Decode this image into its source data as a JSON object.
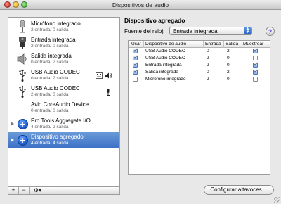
{
  "window": {
    "title": "Dispositivos de audio"
  },
  "devices": [
    {
      "name": "Micrófono integrado",
      "sub": "2 entrada/ 0 salida",
      "icon": "microphone-icon",
      "right_icons": []
    },
    {
      "name": "Entrada integrada",
      "sub": "2 entrada/ 0 salida",
      "icon": "line-in-icon",
      "right_icons": []
    },
    {
      "name": "Salida integrada",
      "sub": "0 entrada/ 2 salida",
      "icon": "speaker-icon",
      "right_icons": []
    },
    {
      "name": "USB Audio CODEC",
      "sub": "0 entrada/ 2 salida",
      "icon": "usb-icon",
      "right_icons": [
        "finder-icon",
        "speaker-volume-icon"
      ]
    },
    {
      "name": "USB Audio CODEC",
      "sub": "2 entrada/ 0 salida",
      "icon": "usb-icon",
      "right_icons": [
        "microphone-small-icon"
      ]
    },
    {
      "name": "Avid CoreAudio Device",
      "sub": "0 entrada/ 0 salida",
      "icon": "",
      "right_icons": []
    },
    {
      "name": "Pro Tools Aggregate I/O",
      "sub": "4 entrada/ 2 salida",
      "icon": "aggregate-icon",
      "right_icons": [],
      "disclosure": true
    },
    {
      "name": "Dispositivo agregado",
      "sub": "4 entrada/ 4 salida",
      "icon": "aggregate-icon",
      "right_icons": [],
      "disclosure": true,
      "selected": true
    }
  ],
  "list_toolbar": {
    "add": "+",
    "remove": "−",
    "gear": "⚙▾"
  },
  "detail": {
    "title": "Dispositivo agregado",
    "clock_label": "Fuente del reloj:",
    "clock_value": "Entrada integrada",
    "help": "?"
  },
  "table": {
    "headers": [
      "Usar",
      "Dispositivo de audio",
      "Entrada",
      "Salida",
      "Muestrear"
    ],
    "rows": [
      {
        "use": true,
        "device": "USB Audio CODEC",
        "in": "0",
        "out": "2",
        "resample": true
      },
      {
        "use": true,
        "device": "USB Audio CODEC",
        "in": "2",
        "out": "0",
        "resample": false
      },
      {
        "use": true,
        "device": "Entrada integrada",
        "in": "2",
        "out": "0",
        "resample": true
      },
      {
        "use": true,
        "device": "Salida integrada",
        "in": "0",
        "out": "2",
        "resample": true
      },
      {
        "use": false,
        "device": "Micrófono integrado",
        "in": "2",
        "out": "0",
        "resample": false
      }
    ]
  },
  "config_button": "Configurar altavoces…"
}
